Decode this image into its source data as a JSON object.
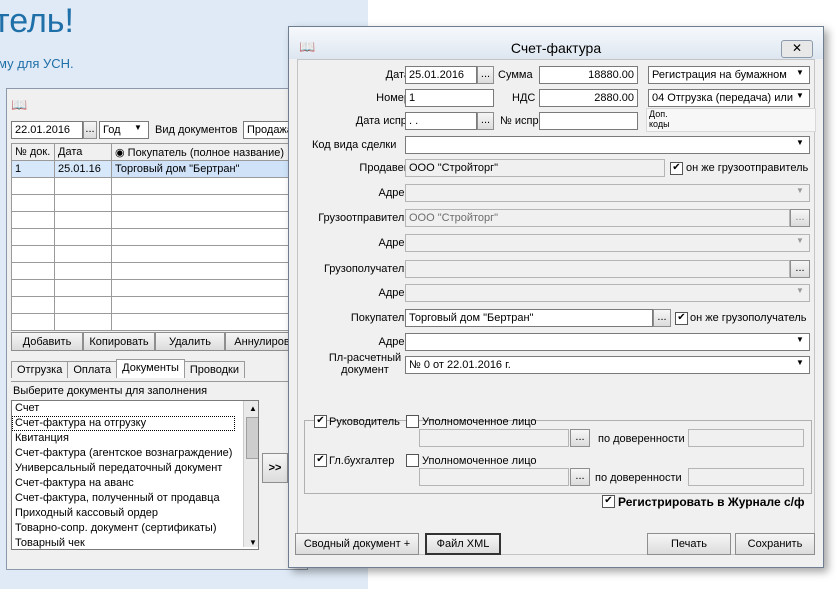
{
  "background": {
    "title": "тель!",
    "subtitle": "му для УСН."
  },
  "back_window": {
    "date": "22.01.2016",
    "date_btn": "...",
    "period": "Год",
    "doc_type_label": "Вид документов",
    "doc_type_value": "Продажа",
    "columns": {
      "num": "№ док.",
      "date": "Дата",
      "buyer_radio": "Покупатель (полное название)"
    },
    "rows": [
      {
        "num": "1",
        "date": "25.01.16",
        "buyer": "Торговый дом \"Бертран\""
      }
    ],
    "buttons": {
      "add": "Добавить",
      "copy": "Копировать",
      "delete": "Удалить",
      "cancel": "Аннулирова"
    },
    "tabs": [
      "Отгрузка",
      "Оплата",
      "Документы",
      "Проводки"
    ],
    "choose_label": "Выберите документы для заполнения",
    "docs": [
      "Счет",
      "Счет-фактура на отгрузку",
      "Квитанция",
      "Счет-фактура (агентское вознаграждение)",
      "Универсальный передаточный документ",
      "Счет-фактура на аванс",
      "Счет-фактура, полученный от продавца",
      "Приходный кассовый ордер",
      "Товарно-сопр. документ (сертификаты)",
      "Товарный чек"
    ],
    "move_btn": ">>"
  },
  "dialog": {
    "title": "Счет-фактура",
    "close": "✕",
    "date_label": "Дата",
    "date": "25.01.2016",
    "sum_label": "Сумма",
    "sum": "18880.00",
    "reg_mode": "Регистрация на бумажном",
    "number_label": "Номер",
    "number": "1",
    "vat_label": "НДС",
    "vat": "2880.00",
    "op_code": "04 Отгрузка (передача) или",
    "extra_codes": "Доп. коды",
    "corr_date_label": "Дата испр.",
    "corr_date": " .  .",
    "corr_num_label": "№ испр.",
    "deal_code_label": "Код вида сделки",
    "seller_label": "Продавец",
    "seller": "ООО \"Стройторг\"",
    "same_shipper": "он же грузоотправитель",
    "address_label": "Адрес",
    "shipper_label": "Грузоотправитель",
    "shipper": "ООО \"Стройторг\"",
    "consignee_label": "Грузополучатель",
    "buyer_label": "Покупатель",
    "buyer": "Торговый дом \"Бертран\"",
    "same_consignee": "он же грузополучатель",
    "payment_doc_label": "Пл-расчетный документ",
    "payment_doc": "№ 0 от 22.01.2016 г.",
    "director": "Руководитель",
    "authorized": "Уполномоченное лицо",
    "by_proxy": "по доверенности",
    "accountant": "Гл.бухгалтер",
    "register_journal": "Регистрировать в Журнале с/ф",
    "buttons": {
      "summary": "Сводный документ +",
      "xml": "Файл XML",
      "print": "Печать",
      "save": "Сохранить"
    }
  }
}
